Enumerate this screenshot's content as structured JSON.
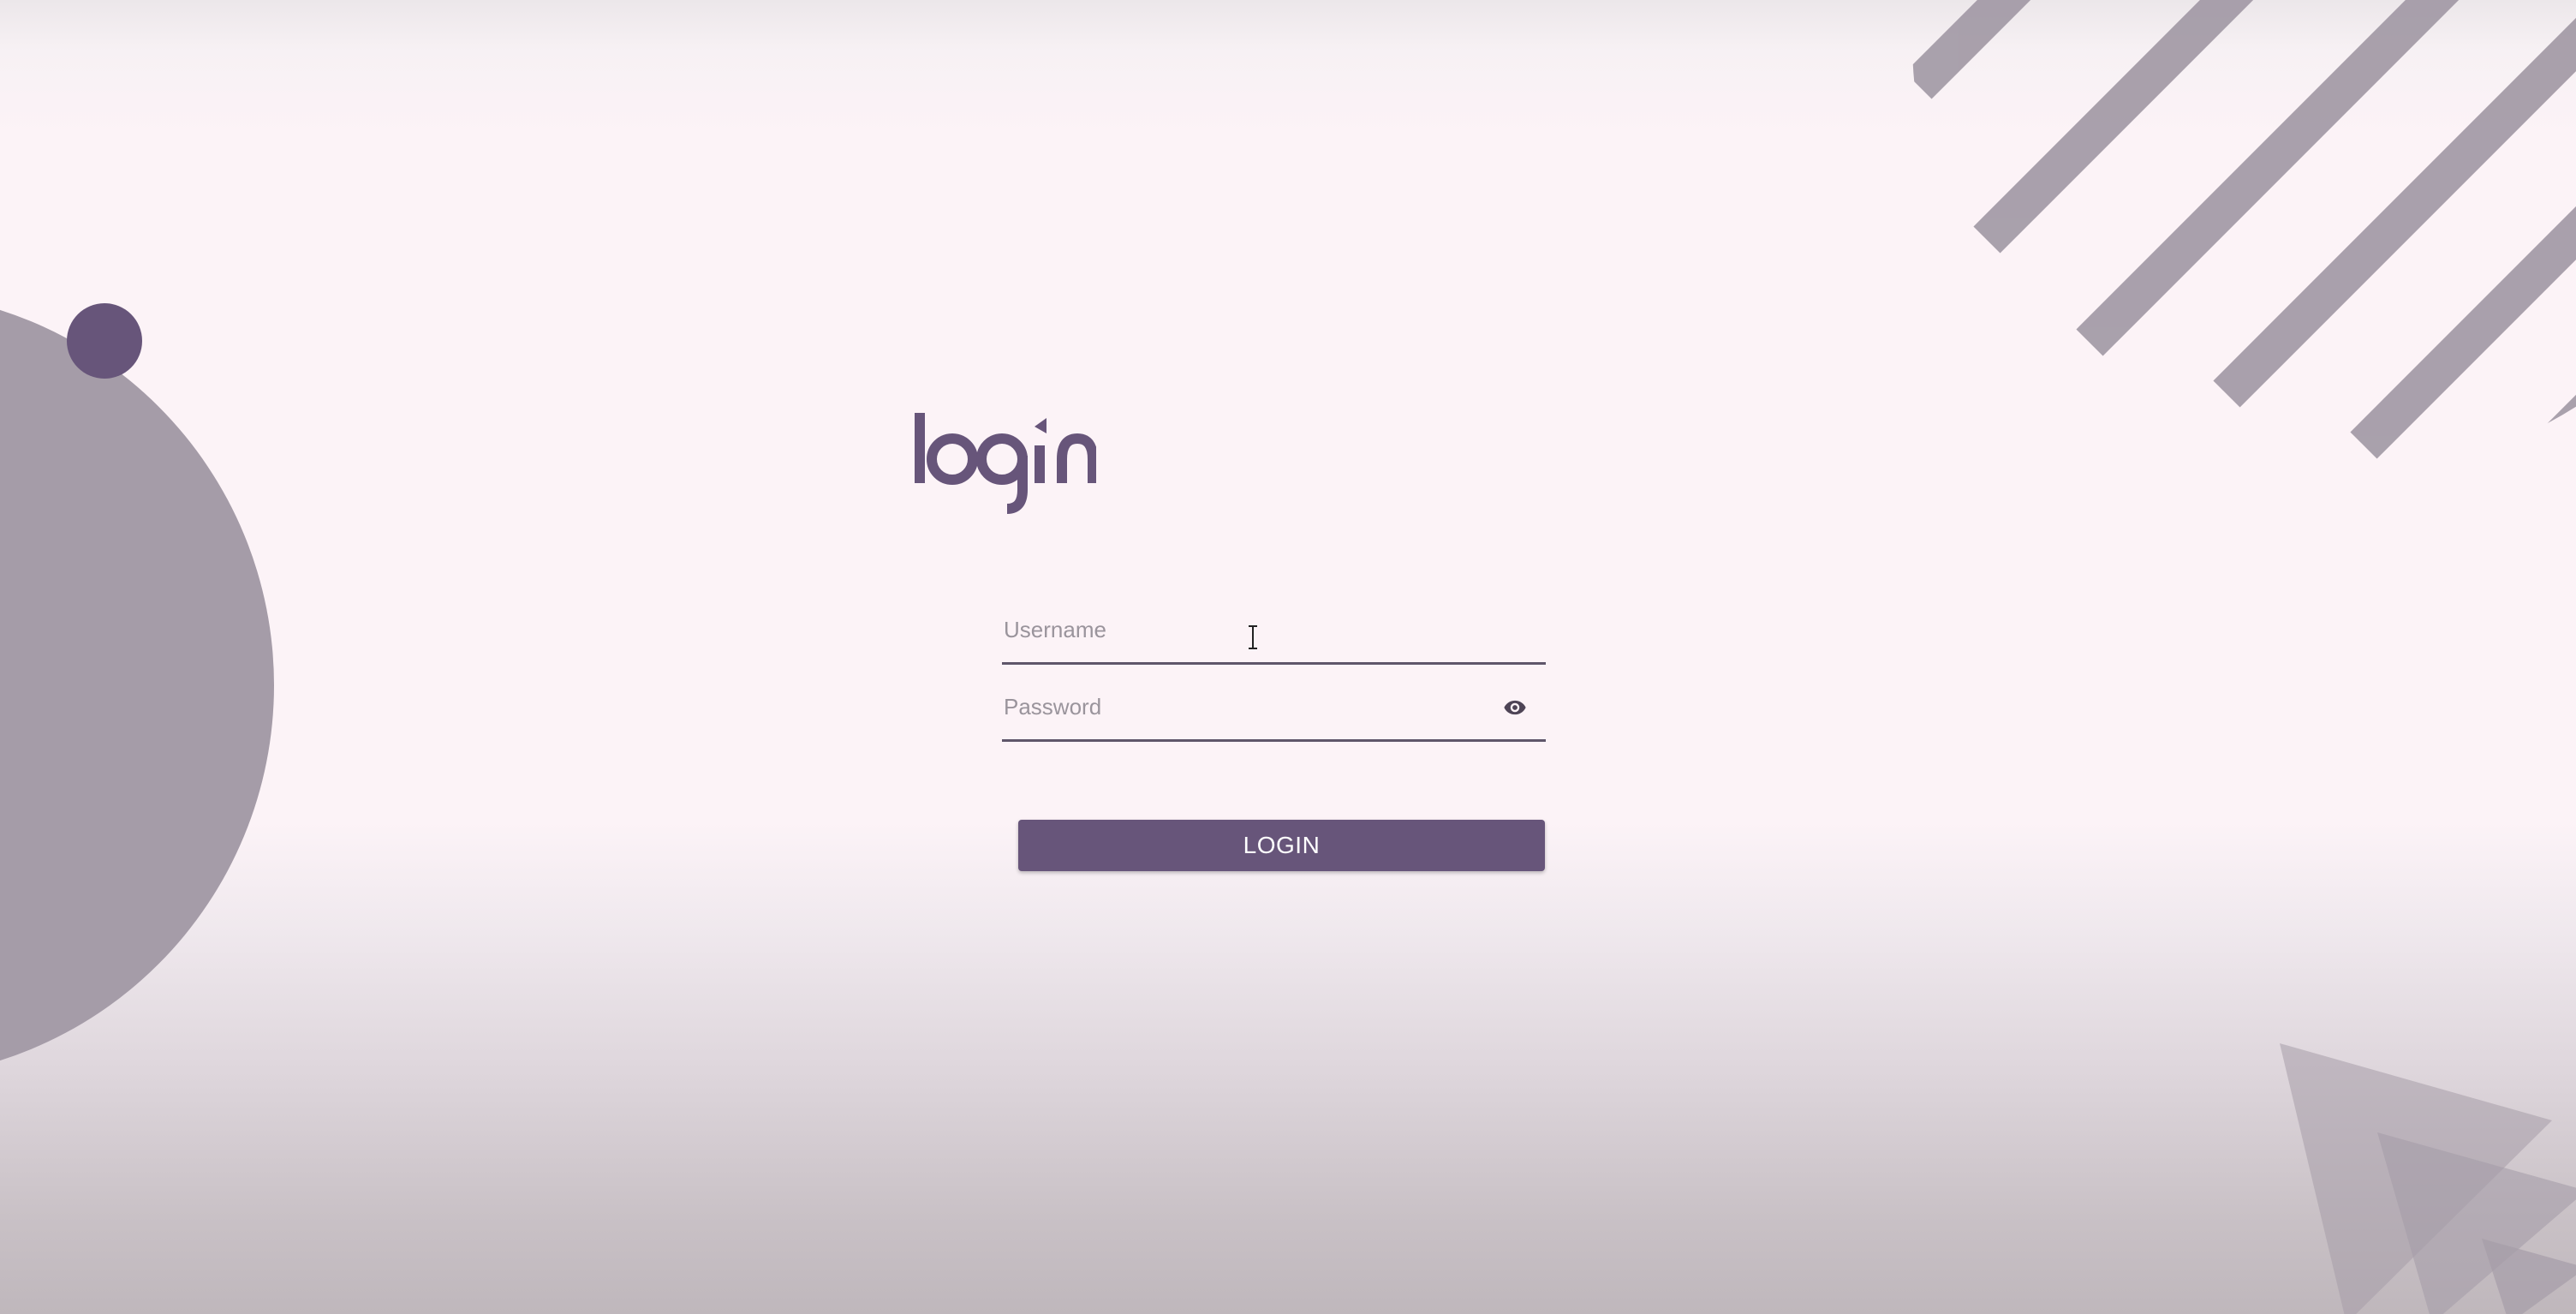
{
  "logo": {
    "text": "login"
  },
  "form": {
    "username": {
      "placeholder": "Username",
      "value": ""
    },
    "password": {
      "placeholder": "Password",
      "value": ""
    },
    "password_visibility_icon": "eye-icon",
    "submit_label": "LOGIN"
  },
  "colors": {
    "accent": "#67557a",
    "background": "#fcf3f7",
    "decor_grey": "#a59ca8",
    "decor_dot": "#67557a"
  }
}
